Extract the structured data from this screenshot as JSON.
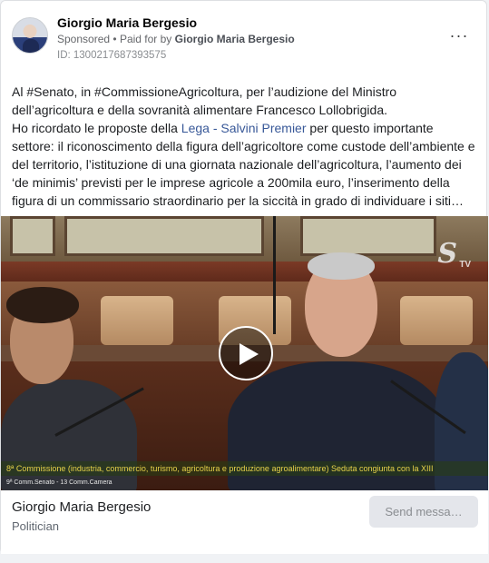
{
  "post": {
    "author": "Giorgio Maria Bergesio",
    "sponsored_label": "Sponsored",
    "separator": "•",
    "paid_for_prefix": "Paid for by",
    "paid_for_by": "Giorgio Maria Bergesio",
    "ad_id": "ID: 1300217687393575",
    "more_options_icon": "more-horizontal-icon",
    "text": {
      "line1": "Al #Senato, in #CommissioneAgricoltura, per l’audizione del Ministro dell’agricoltura e della sovranità alimentare Francesco Lollobrigida.",
      "line2_prefix": "Ho ricordato le proposte della ",
      "line2_link": "Lega - Salvini Premier",
      "line2_suffix": " per questo importante settore: il riconoscimento della figura dell’agricoltore come custode dell’ambiente e del territorio, l’istituzione di una giornata nazionale dell’agricoltura, l’aumento dei ‘de minimis’ previsti per le imprese agricole a 200mila euro, l’inserimento della figura di un commissario straordinario per la siccità in grado di individuare i siti…"
    }
  },
  "video": {
    "logo_letter": "S",
    "logo_tv": "TV",
    "ticker": "8ª Commissione (industria, commercio, turismo, agricoltura e produzione agroalimentare) Seduta congiunta con la XIII",
    "channel_tag": "9ª Comm.Senato - 13 Comm.Camera",
    "play_icon": "play-icon"
  },
  "footer": {
    "page_name": "Giorgio Maria Bergesio",
    "category": "Politician",
    "cta_label": "Send messa…"
  },
  "colors": {
    "link": "#385898",
    "cta_bg": "#e4e6eb",
    "text": "#1c1e21"
  }
}
